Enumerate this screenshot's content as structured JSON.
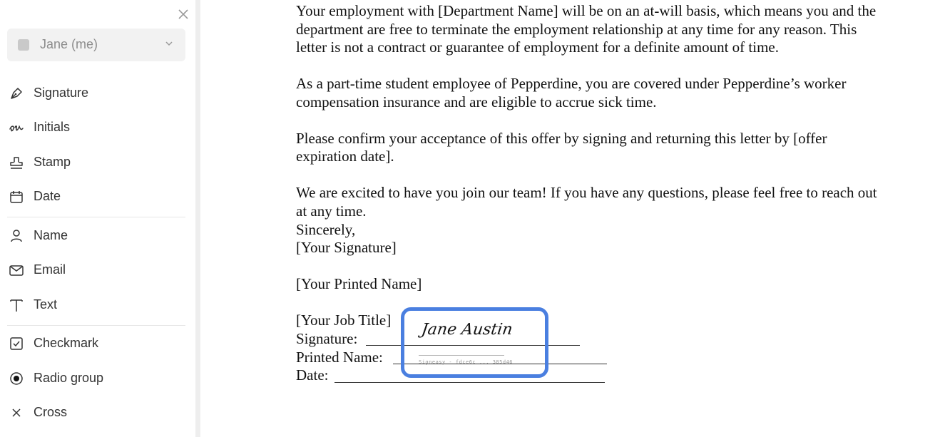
{
  "sidebar": {
    "signer": {
      "label": "Jane (me)"
    },
    "items": [
      {
        "label": "Signature",
        "icon": "pen-nib-icon"
      },
      {
        "label": "Initials",
        "icon": "initials-icon"
      },
      {
        "label": "Stamp",
        "icon": "stamp-icon"
      },
      {
        "label": "Date",
        "icon": "calendar-icon"
      },
      {
        "label": "Name",
        "icon": "person-icon"
      },
      {
        "label": "Email",
        "icon": "envelope-icon"
      },
      {
        "label": "Text",
        "icon": "text-icon"
      },
      {
        "label": "Checkmark",
        "icon": "checkbox-icon"
      },
      {
        "label": "Radio group",
        "icon": "radio-icon"
      },
      {
        "label": "Cross",
        "icon": "cross-icon"
      }
    ]
  },
  "document": {
    "lines": [
      "Your employment with [Department Name] will be on an at-will basis, which means you and the",
      "department are free to terminate the employment relationship at any time for any reason. This",
      "letter is not a contract or guarantee of employment for a definite amount of time.",
      "As a part-time student employee of Pepperdine, you are covered under Pepperdine’s worker",
      "compensation insurance and are eligible to accrue sick time.",
      "Please confirm your acceptance of this offer by signing and returning this letter by [offer",
      "expiration date].",
      "We are excited to have you join our team! If you have any questions, please feel free to reach out",
      "at any time.",
      "Sincerely,",
      "[Your Signature]",
      "[Your Printed Name]",
      "[Your Job Title]",
      "Signature:",
      "Printed Name:",
      "Date:"
    ]
  },
  "signature_field": {
    "signed_name": "Jane Austin",
    "signature_id": "Signeasy - fdce6c ... 385d46"
  },
  "colors": {
    "accent": "#4a7fe0",
    "sidebar_text": "#333333",
    "muted": "#8c8c8c"
  }
}
